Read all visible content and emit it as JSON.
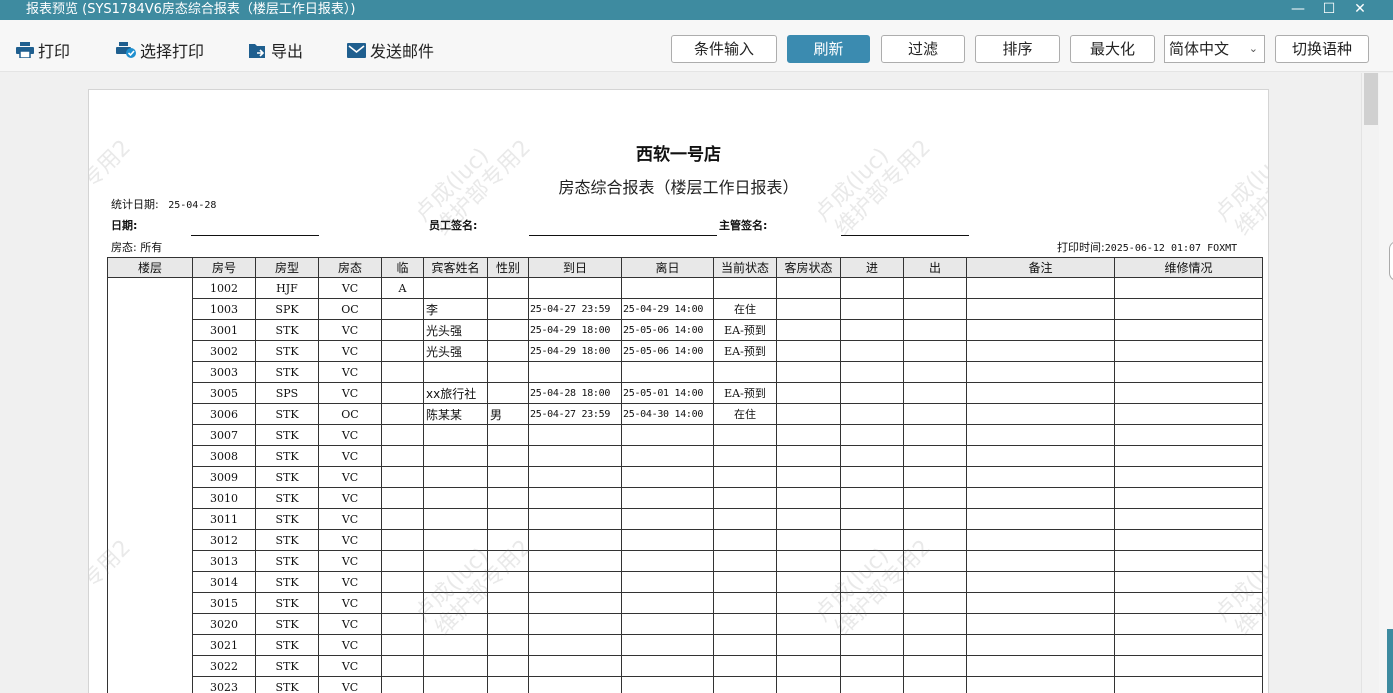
{
  "window": {
    "title": "报表预览 (SYS1784V6房态综合报表（楼层工作日报表）)",
    "controls": [
      "—",
      "☐",
      "✕"
    ]
  },
  "toolbar": {
    "print": "打印",
    "select_print": "选择打印",
    "export": "导出",
    "send_email": "发送邮件",
    "condition_input": "条件输入",
    "refresh": "刷新",
    "filter": "过滤",
    "sort": "排序",
    "maximize": "最大化",
    "language": "简体中文",
    "switch_language": "切换语种",
    "accent_color": "#3b8bb0"
  },
  "report": {
    "store_name": "西软一号店",
    "title": "房态综合报表（楼层工作日报表）",
    "stat_date_label": "统计日期:",
    "stat_date": "25-04-28",
    "date_label": "日期:",
    "staff_sign_label": "员工签名:",
    "supervisor_sign_label": "主管签名:",
    "status_label": "房态: 所有",
    "print_time_label": "打印时间:",
    "print_time": "2025-06-12 01:07 FOXMT",
    "watermark_line1": "卢成(luc)",
    "watermark_line2": "维护部专用2",
    "columns": [
      "楼层",
      "房号",
      "房型",
      "房态",
      "临",
      "宾客姓名",
      "性别",
      "到日",
      "离日",
      "当前状态",
      "客房状态",
      "进",
      "出",
      "备注",
      "维修情况"
    ],
    "rows": [
      {
        "room": "1002",
        "type": "HJF",
        "status": "VC",
        "temp": "A",
        "guest": "",
        "gender": "",
        "arrival": "",
        "departure": "",
        "current": ""
      },
      {
        "room": "1003",
        "type": "SPK",
        "status": "OC",
        "temp": "",
        "guest": "李",
        "gender": "",
        "arrival": "25-04-27 23:59",
        "departure": "25-04-29 14:00",
        "current": "在住"
      },
      {
        "room": "3001",
        "type": "STK",
        "status": "VC",
        "temp": "",
        "guest": "光头强",
        "gender": "",
        "arrival": "25-04-29 18:00",
        "departure": "25-05-06 14:00",
        "current": "EA-预到"
      },
      {
        "room": "3002",
        "type": "STK",
        "status": "VC",
        "temp": "",
        "guest": "光头强",
        "gender": "",
        "arrival": "25-04-29 18:00",
        "departure": "25-05-06 14:00",
        "current": "EA-预到"
      },
      {
        "room": "3003",
        "type": "STK",
        "status": "VC",
        "temp": "",
        "guest": "",
        "gender": "",
        "arrival": "",
        "departure": "",
        "current": ""
      },
      {
        "room": "3005",
        "type": "SPS",
        "status": "VC",
        "temp": "",
        "guest": "xx旅行社",
        "gender": "",
        "arrival": "25-04-28 18:00",
        "departure": "25-05-01 14:00",
        "current": "EA-预到"
      },
      {
        "room": "3006",
        "type": "STK",
        "status": "OC",
        "temp": "",
        "guest": "陈某某",
        "gender": "男",
        "arrival": "25-04-27 23:59",
        "departure": "25-04-30 14:00",
        "current": "在住"
      },
      {
        "room": "3007",
        "type": "STK",
        "status": "VC",
        "temp": "",
        "guest": "",
        "gender": "",
        "arrival": "",
        "departure": "",
        "current": ""
      },
      {
        "room": "3008",
        "type": "STK",
        "status": "VC",
        "temp": "",
        "guest": "",
        "gender": "",
        "arrival": "",
        "departure": "",
        "current": ""
      },
      {
        "room": "3009",
        "type": "STK",
        "status": "VC",
        "temp": "",
        "guest": "",
        "gender": "",
        "arrival": "",
        "departure": "",
        "current": ""
      },
      {
        "room": "3010",
        "type": "STK",
        "status": "VC",
        "temp": "",
        "guest": "",
        "gender": "",
        "arrival": "",
        "departure": "",
        "current": ""
      },
      {
        "room": "3011",
        "type": "STK",
        "status": "VC",
        "temp": "",
        "guest": "",
        "gender": "",
        "arrival": "",
        "departure": "",
        "current": ""
      },
      {
        "room": "3012",
        "type": "STK",
        "status": "VC",
        "temp": "",
        "guest": "",
        "gender": "",
        "arrival": "",
        "departure": "",
        "current": ""
      },
      {
        "room": "3013",
        "type": "STK",
        "status": "VC",
        "temp": "",
        "guest": "",
        "gender": "",
        "arrival": "",
        "departure": "",
        "current": ""
      },
      {
        "room": "3014",
        "type": "STK",
        "status": "VC",
        "temp": "",
        "guest": "",
        "gender": "",
        "arrival": "",
        "departure": "",
        "current": ""
      },
      {
        "room": "3015",
        "type": "STK",
        "status": "VC",
        "temp": "",
        "guest": "",
        "gender": "",
        "arrival": "",
        "departure": "",
        "current": ""
      },
      {
        "room": "3020",
        "type": "STK",
        "status": "VC",
        "temp": "",
        "guest": "",
        "gender": "",
        "arrival": "",
        "departure": "",
        "current": ""
      },
      {
        "room": "3021",
        "type": "STK",
        "status": "VC",
        "temp": "",
        "guest": "",
        "gender": "",
        "arrival": "",
        "departure": "",
        "current": ""
      },
      {
        "room": "3022",
        "type": "STK",
        "status": "VC",
        "temp": "",
        "guest": "",
        "gender": "",
        "arrival": "",
        "departure": "",
        "current": ""
      },
      {
        "room": "3023",
        "type": "STK",
        "status": "VC",
        "temp": "",
        "guest": "",
        "gender": "",
        "arrival": "",
        "departure": "",
        "current": ""
      }
    ]
  }
}
